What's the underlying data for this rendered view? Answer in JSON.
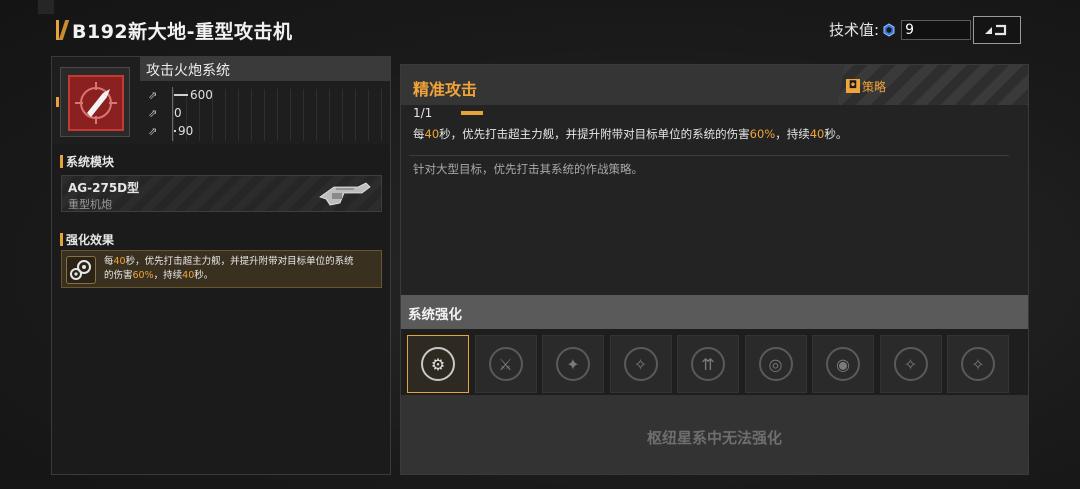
{
  "header": {
    "title": "B192新大地-重型攻击机",
    "tech_label": "技术值:",
    "tech_value": "9",
    "icons": {
      "tech": "crystal-icon",
      "back": "return-arrow-icon"
    }
  },
  "system": {
    "name": "攻击火炮系统",
    "icon": "artillery-target-icon",
    "stats": [
      {
        "icon": "attack-stat-icon",
        "value": "600"
      },
      {
        "icon": "speed-stat-icon",
        "value": "0"
      },
      {
        "icon": "range-stat-icon",
        "value": "90"
      }
    ]
  },
  "module": {
    "section_label": "系统模块",
    "name": "AG-275D型",
    "type": "重型机炮"
  },
  "effect": {
    "section_label": "强化效果",
    "text_1": "每",
    "n1": "40",
    "text_2": "秒，优先打击超主力舰，并提升附带对目标单位的系统",
    "text_3": "的伤害",
    "pct": "60%",
    "text_4": "，持续",
    "n2": "40",
    "text_5": "秒。"
  },
  "skill": {
    "title": "精准攻击",
    "strategy_label": "策略",
    "level": "1/1",
    "desc_1": "每",
    "n1": "40",
    "desc_2": "秒，优先打击超主力舰，并提升附带对目标单位的系统的伤害",
    "pct": "60%",
    "desc_3": "，持续",
    "n2": "40",
    "desc_4": "秒。",
    "flavor": "针对大型目标，优先打击其系统的作战策略。"
  },
  "enhance": {
    "title": "系统强化",
    "locked_text": "枢纽星系中无法强化",
    "slots": [
      {
        "icon": "gears-icon",
        "glyph": "⚙",
        "active": true
      },
      {
        "icon": "sword-plus-icon",
        "glyph": "⚔",
        "active": false
      },
      {
        "icon": "cannon-plus-icon",
        "glyph": "✦",
        "active": false
      },
      {
        "icon": "blade-icon",
        "glyph": "✧",
        "active": false
      },
      {
        "icon": "speed-arrows-icon",
        "glyph": "⇈",
        "active": false
      },
      {
        "icon": "target-rotate-icon",
        "glyph": "◎",
        "active": false
      },
      {
        "icon": "radar-icon",
        "glyph": "◉",
        "active": false
      },
      {
        "icon": "blade-alt-icon",
        "glyph": "✧",
        "active": false
      },
      {
        "icon": "blade-third-icon",
        "glyph": "✧",
        "active": false
      }
    ]
  },
  "colors": {
    "accent": "#e8a23a",
    "highlight": "#f0a43a",
    "danger": "#8a2020"
  }
}
